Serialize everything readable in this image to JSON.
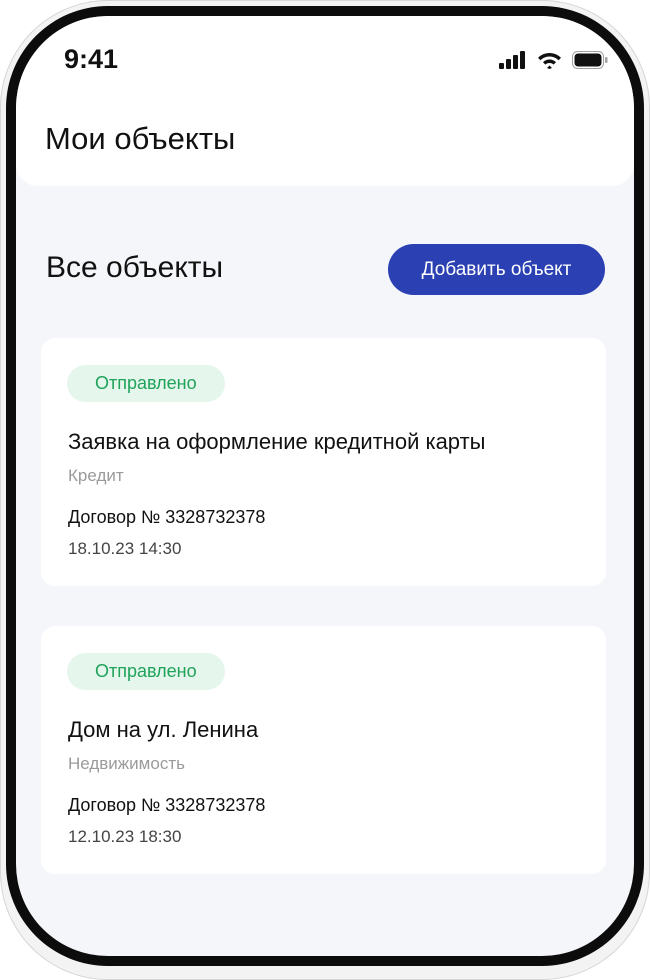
{
  "status_bar": {
    "time": "9:41",
    "icons": [
      "cellular-signal-icon",
      "wifi-icon",
      "battery-icon"
    ]
  },
  "header": {
    "title": "Мои объекты"
  },
  "section": {
    "title": "Все объекты",
    "add_button_label": "Добавить объект"
  },
  "objects": [
    {
      "status": "Отправлено",
      "title": "Заявка на оформление кредитной карты",
      "category": "Кредит",
      "contract": "Договор № 3328732378",
      "datetime": "18.10.23 14:30"
    },
    {
      "status": "Отправлено",
      "title": "Дом на ул. Ленина",
      "category": "Недвижимость",
      "contract": "Договор № 3328732378",
      "datetime": "12.10.23 18:30"
    }
  ],
  "colors": {
    "accent": "#2b40b2",
    "status_sent_bg": "#e5f6ec",
    "status_sent_text": "#1fa25a",
    "background": "#f5f6f9"
  }
}
